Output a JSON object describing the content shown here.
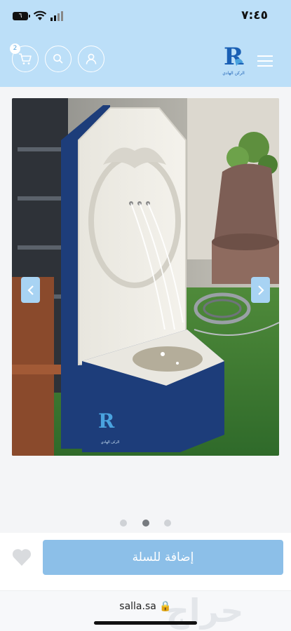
{
  "status_bar": {
    "battery": "٦",
    "time": "٧:٤٥"
  },
  "header": {
    "cart_count": "2",
    "icons": [
      "cart-icon",
      "search-icon",
      "user-icon",
      "menu-icon"
    ],
    "logo_letter": "R",
    "logo_text": "الركن الهادي"
  },
  "gallery": {
    "watermark_logo_letter": "R",
    "watermark_logo_text": "الركن الهادي",
    "slide_index": 2,
    "slide_count": 3
  },
  "action": {
    "add_to_cart_label": "إضافة للسلة"
  },
  "browser": {
    "url": "salla.sa 🔒",
    "watermark": "حراج"
  },
  "colors": {
    "header_bg": "#bcdff8",
    "button_bg": "#8cbfe8",
    "arrow_bg": "#a8d3f3"
  }
}
